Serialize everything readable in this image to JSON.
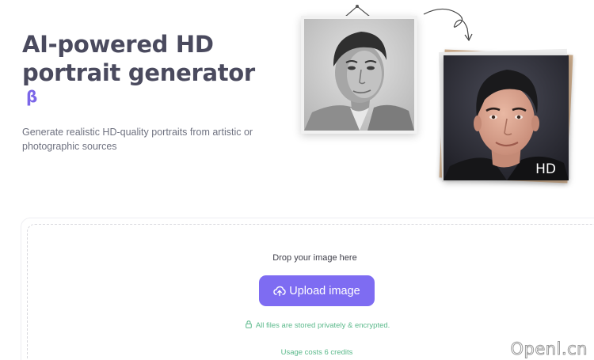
{
  "hero": {
    "title": "AI-powered HD portrait generator",
    "badge": "β",
    "subtitle": "Generate realistic HD-quality portraits from artistic or photographic sources"
  },
  "showcase": {
    "result_badge": "HD"
  },
  "upload": {
    "drop_text": "Drop your image here",
    "button_label": "Upload image",
    "privacy_note": "All files are stored privately & encrypted.",
    "credits_note": "Usage costs 6 credits"
  },
  "watermark": "Openl.cn",
  "colors": {
    "accent": "#7e6cf2",
    "title": "#4a4a5e",
    "note_green": "#5bb98b"
  },
  "icons": [
    "lock-icon",
    "cloud-upload-icon",
    "curved-arrow-icon"
  ]
}
